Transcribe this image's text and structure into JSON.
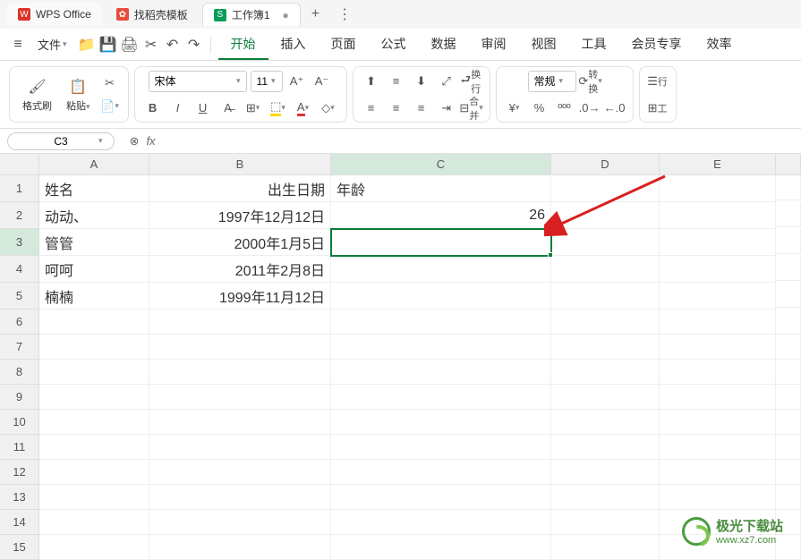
{
  "tabs": {
    "app": {
      "label": "WPS Office"
    },
    "tpl": {
      "label": "找稻壳模板"
    },
    "doc": {
      "label": "工作簿1"
    },
    "add": "+"
  },
  "menu": {
    "hamburger": "≡",
    "file": "文件",
    "items": [
      "开始",
      "插入",
      "页面",
      "公式",
      "数据",
      "审阅",
      "视图",
      "工具",
      "会员专享",
      "效率"
    ],
    "active": "开始"
  },
  "ribbon": {
    "format_painter": "格式刷",
    "paste": "粘贴",
    "font": "宋体",
    "font_size": "11",
    "bold": "B",
    "italic": "I",
    "underline": "U",
    "normal": "常规",
    "convert": "转换",
    "rows": "行",
    "tool": "工",
    "wrap": "换行",
    "merge": "合并"
  },
  "namebox": {
    "cell": "C3",
    "fx": "fx"
  },
  "columns": [
    "A",
    "B",
    "C",
    "D",
    "E"
  ],
  "row_headers": [
    "1",
    "2",
    "3",
    "4",
    "5",
    "6",
    "7",
    "8",
    "9",
    "10",
    "11",
    "12",
    "13",
    "14",
    "15"
  ],
  "cells": {
    "A1": "姓名",
    "B1": "出生日期",
    "C1": "年龄",
    "A2": "动动、",
    "B2": "1997年12月12日",
    "C2": "26",
    "A3": "管管",
    "B3": "2000年1月5日",
    "A4": "呵呵",
    "B4": "2011年2月8日",
    "A5": "楠楠",
    "B5": "1999年11月12日"
  },
  "selected": "C3",
  "watermark": {
    "name": "极光下载站",
    "url": "www.xz7.com"
  }
}
